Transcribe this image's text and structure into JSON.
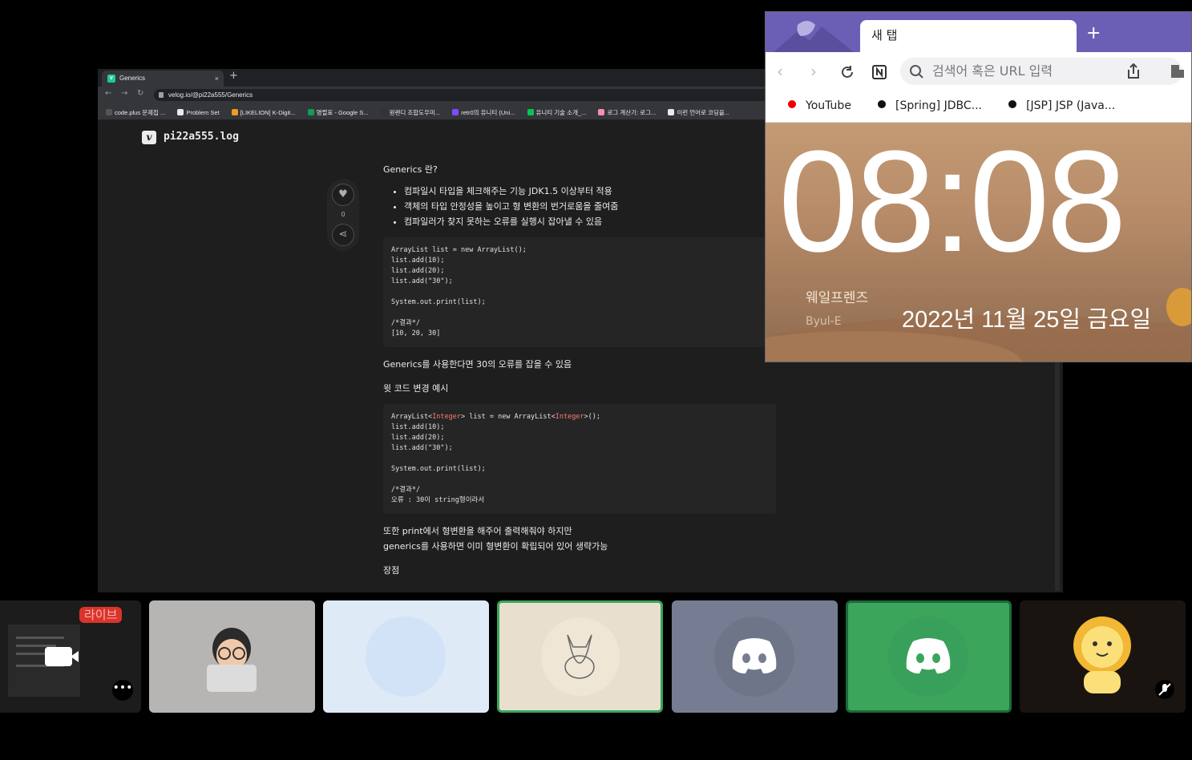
{
  "chrome": {
    "tab_title": "Generics",
    "tab_close": "×",
    "new_tab": "+",
    "url": "velog.io/@pi22a555/Generics",
    "bookmarks": [
      {
        "label": "code.plus 문제집 ...",
        "color": "#555555"
      },
      {
        "label": "Problem Set",
        "color": "#e8eaed"
      },
      {
        "label": "[LIKELION] K-Digit...",
        "color": "#f29a1f"
      },
      {
        "label": "명렬표 - Google S...",
        "color": "#0f9d58"
      },
      {
        "label": "원랜디 조합도우미...",
        "color": "#333333"
      },
      {
        "label": "retr0의 유니티 (Uni...",
        "color": "#7c4dff"
      },
      {
        "label": "유니티 기술 소개_...",
        "color": "#00c853"
      },
      {
        "label": "로그 계산기: 로그...",
        "color": "#f48fb1"
      },
      {
        "label": "이런 언어로 코딩을...",
        "color": "#e8eaed"
      }
    ]
  },
  "velog": {
    "blog_name": "pi22a555.log",
    "logo": "v",
    "like_count": "0",
    "heading": "Generics 란?",
    "bullets": [
      "컴파일시 타입을 체크해주는 기능 JDK1.5 이상부터 적용",
      "객체의 타입 안정성을 높이고 형 변환의 번거로움을 줄여줌",
      "컴파일러가 찾지 못하는 오류를 실행시 잡아낼 수 있음"
    ],
    "code1": "ArrayList list = new ArrayList();\nlist.add(10);\nlist.add(20);\nlist.add(\"30\");\n\nSystem.out.print(list);\n\n/*결과*/\n[10, 20, 30]",
    "para1": "Generics를 사용한다면 30의 오류를 잡을 수 있음",
    "para2": "윗 코드 변경 예시",
    "code2_pre1": "ArrayList<",
    "code2_kw1": "Integer",
    "code2_mid": "> list = new ArrayList<",
    "code2_kw2": "Integer",
    "code2_post": ">();",
    "code2_rest": "list.add(10);\nlist.add(20);\nlist.add(\"30\");\n\nSystem.out.print(list);\n\n/*결과*/\n오류 : 30이 string형이라서",
    "para3_line1": "또한 print에서 형변환을 해주어 출력해줘야 하지만",
    "para3_line2": "generics를 사용하면 이미 형변환이 확립되어 있어 생략가능",
    "para4": "장점"
  },
  "whale": {
    "tab_title": "새 탭",
    "new_tab": "+",
    "search_placeholder": "검색어 혹은 URL 입력",
    "bookmarks": [
      "YouTube",
      "[Spring] JDBC...",
      "[JSP] JSP (Java..."
    ],
    "clock": "08:08",
    "date": "2022년 11월 25일 금요일",
    "credit": "웨일프렌즈",
    "credit_author": "Byul-E"
  },
  "tiles": {
    "live_badge": "라이브",
    "more": "•••"
  },
  "colors": {
    "discord_blurple_bg": "#767d92",
    "speaking_green": "#3ba55c",
    "live_red": "#d9342b",
    "whale_purple": "#6b5fb5"
  }
}
